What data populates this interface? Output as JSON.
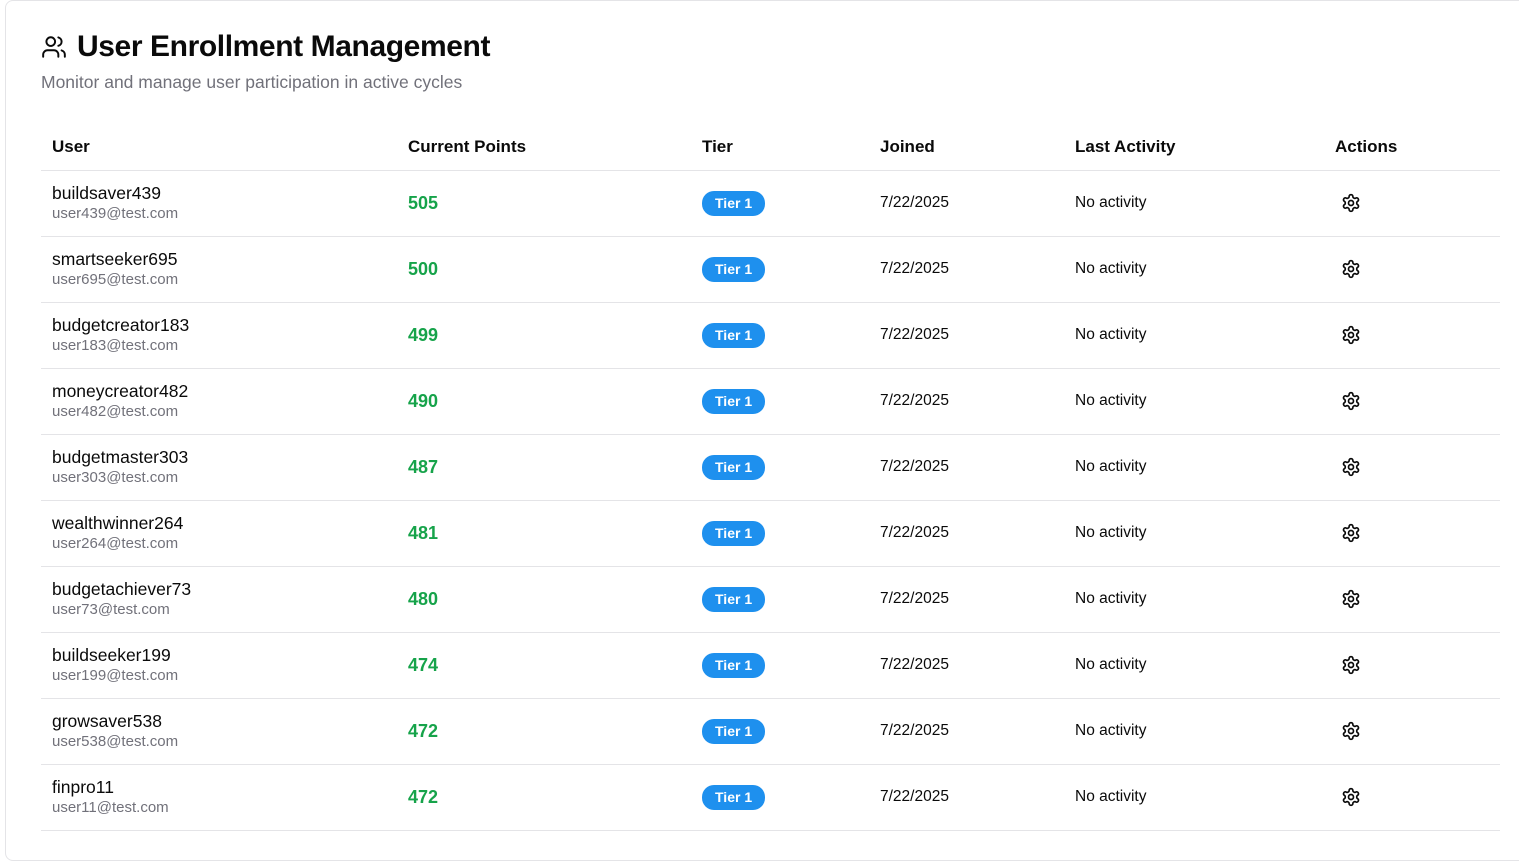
{
  "header": {
    "title": "User Enrollment Management",
    "subtitle": "Monitor and manage user participation in active cycles",
    "icon": "users-icon"
  },
  "table": {
    "columns": [
      "User",
      "Current Points",
      "Tier",
      "Joined",
      "Last Activity",
      "Actions"
    ],
    "rows": [
      {
        "username": "buildsaver439",
        "email": "user439@test.com",
        "points": "505",
        "tier": "Tier 1",
        "joined": "7/22/2025",
        "last_activity": "No activity"
      },
      {
        "username": "smartseeker695",
        "email": "user695@test.com",
        "points": "500",
        "tier": "Tier 1",
        "joined": "7/22/2025",
        "last_activity": "No activity"
      },
      {
        "username": "budgetcreator183",
        "email": "user183@test.com",
        "points": "499",
        "tier": "Tier 1",
        "joined": "7/22/2025",
        "last_activity": "No activity"
      },
      {
        "username": "moneycreator482",
        "email": "user482@test.com",
        "points": "490",
        "tier": "Tier 1",
        "joined": "7/22/2025",
        "last_activity": "No activity"
      },
      {
        "username": "budgetmaster303",
        "email": "user303@test.com",
        "points": "487",
        "tier": "Tier 1",
        "joined": "7/22/2025",
        "last_activity": "No activity"
      },
      {
        "username": "wealthwinner264",
        "email": "user264@test.com",
        "points": "481",
        "tier": "Tier 1",
        "joined": "7/22/2025",
        "last_activity": "No activity"
      },
      {
        "username": "budgetachiever73",
        "email": "user73@test.com",
        "points": "480",
        "tier": "Tier 1",
        "joined": "7/22/2025",
        "last_activity": "No activity"
      },
      {
        "username": "buildseeker199",
        "email": "user199@test.com",
        "points": "474",
        "tier": "Tier 1",
        "joined": "7/22/2025",
        "last_activity": "No activity"
      },
      {
        "username": "growsaver538",
        "email": "user538@test.com",
        "points": "472",
        "tier": "Tier 1",
        "joined": "7/22/2025",
        "last_activity": "No activity"
      },
      {
        "username": "finpro11",
        "email": "user11@test.com",
        "points": "472",
        "tier": "Tier 1",
        "joined": "7/22/2025",
        "last_activity": "No activity"
      }
    ],
    "action_icon": "gear-icon"
  },
  "colors": {
    "points_green": "#16a34a",
    "tier_badge_blue": "#1e90ee",
    "muted_text": "#71717a",
    "border": "#e4e4e7"
  }
}
